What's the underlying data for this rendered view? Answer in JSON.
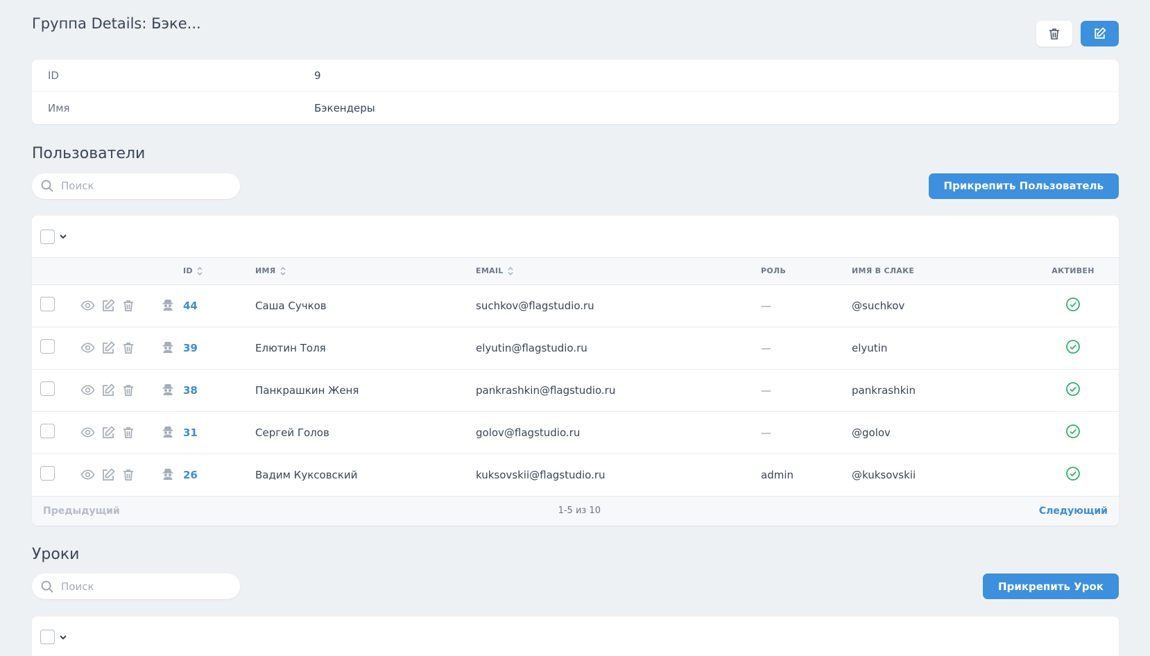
{
  "header": {
    "title": "Группа Details: Бэке..."
  },
  "details": {
    "rows": [
      {
        "label": "ID",
        "value": "9"
      },
      {
        "label": "Имя",
        "value": "Бэкендеры"
      }
    ]
  },
  "users": {
    "title": "Пользователи",
    "search_placeholder": "Поиск",
    "attach_label": "Прикрепить Пользователь",
    "columns": {
      "id": "ID",
      "name": "ИМЯ",
      "email": "EMAIL",
      "role": "РОЛЬ",
      "slack": "ИМЯ В СЛАКЕ",
      "active": "АКТИВЕН"
    },
    "rows": [
      {
        "id": "44",
        "name": "Саша Сучков",
        "email": "suchkov@flagstudio.ru",
        "role": "—",
        "slack": "@suchkov",
        "active": true
      },
      {
        "id": "39",
        "name": "Елютин Толя",
        "email": "elyutin@flagstudio.ru",
        "role": "—",
        "slack": "elyutin",
        "active": true
      },
      {
        "id": "38",
        "name": "Панкрашкин Женя",
        "email": "pankrashkin@flagstudio.ru",
        "role": "—",
        "slack": "pankrashkin",
        "active": true
      },
      {
        "id": "31",
        "name": "Сергей Голов",
        "email": "golov@flagstudio.ru",
        "role": "—",
        "slack": "@golov",
        "active": true
      },
      {
        "id": "26",
        "name": "Вадим Куксовский",
        "email": "kuksovskii@flagstudio.ru",
        "role": "admin",
        "slack": "@kuksovskii",
        "active": true
      }
    ],
    "pager": {
      "prev": "Предыдущий",
      "info": "1-5 из 10",
      "next": "Следующий"
    }
  },
  "lessons": {
    "title": "Уроки",
    "search_placeholder": "Поиск",
    "attach_label": "Прикрепить Урок"
  },
  "colors": {
    "accent": "#3d90dd",
    "link": "#3d8cd6",
    "success": "#2fb26b",
    "background": "#eef1f4"
  }
}
